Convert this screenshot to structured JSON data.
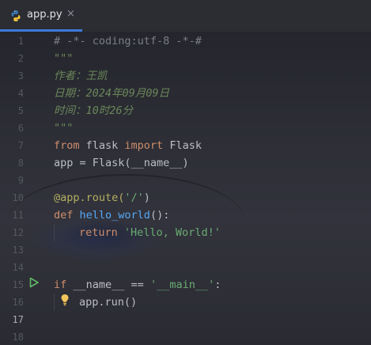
{
  "tab": {
    "icon": "python-file-icon",
    "filename": "app.py",
    "close_glyph": "×"
  },
  "gutter": {
    "line_numbers": [
      "1",
      "2",
      "3",
      "4",
      "5",
      "6",
      "7",
      "8",
      "9",
      "10",
      "11",
      "12",
      "13",
      "14",
      "15",
      "16",
      "17",
      "18"
    ],
    "current_line": "17"
  },
  "code": {
    "l1": "# -*- coding:utf-8 -*-#",
    "l2": "\"\"\"",
    "l3": "作者：王凯",
    "l4": "日期：2024年09月09日",
    "l5": "时间：10时26分",
    "l6": "\"\"\"",
    "l7_kw1": "from",
    "l7_mod": " flask ",
    "l7_kw2": "import",
    "l7_name": " Flask",
    "l8": "app = Flask(__name__)",
    "l10_dec": "@app.route(",
    "l10_str": "'/'",
    "l10_end": ")",
    "l11_kw": "def",
    "l11_fn": " hello_world",
    "l11_end": "():",
    "l12_kw": "return",
    "l12_str": " 'Hello, World!'",
    "l15_kw": "if",
    "l15_mid": " __name__ == ",
    "l15_str": "'__main__'",
    "l15_end": ":",
    "l16": "app.run()"
  },
  "colors": {
    "accent": "#3d7bd9",
    "keyword": "#cf8e6d",
    "function": "#56a8f5",
    "string": "#6aab73",
    "comment": "#7a7e85",
    "docstring": "#6a8759",
    "decorator": "#b3ae60"
  }
}
